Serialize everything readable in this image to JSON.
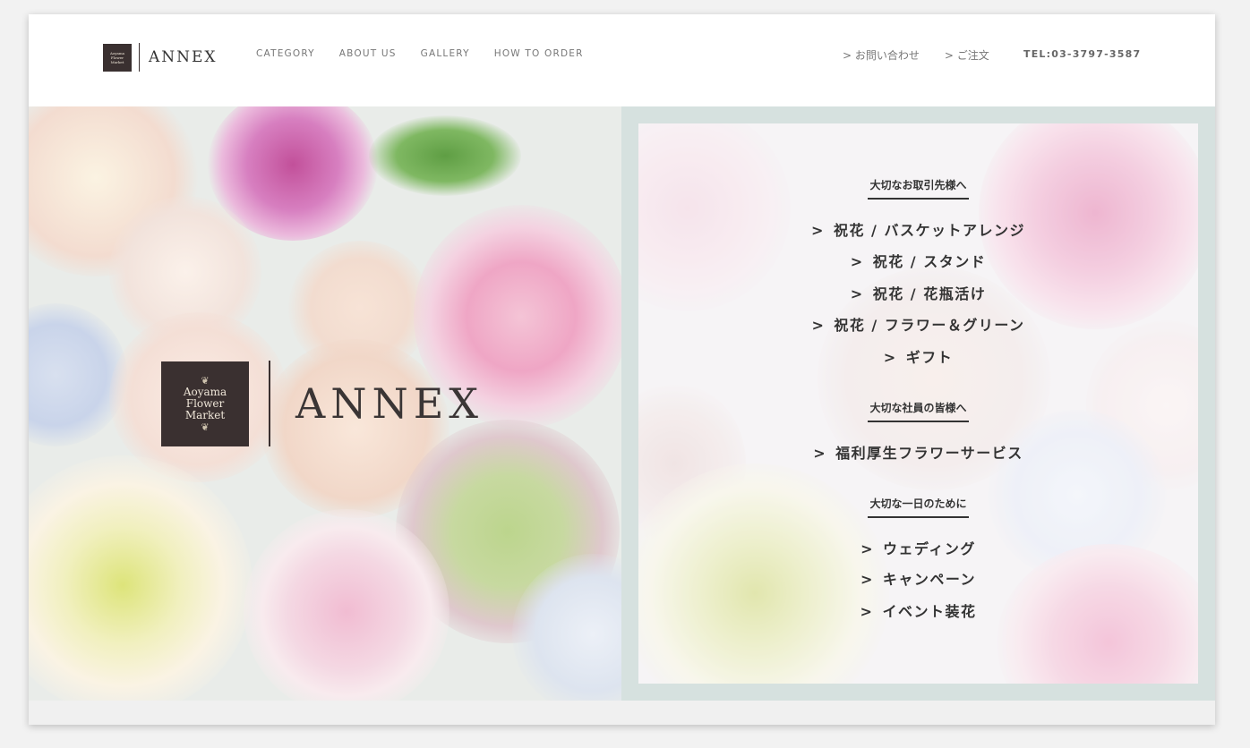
{
  "header": {
    "logo_badge_line1": "Aoyama",
    "logo_badge_line2": "Flower",
    "logo_badge_line3": "Market",
    "logo_text": "ANNEX",
    "nav": [
      "CATEGORY",
      "ABOUT US",
      "GALLERY",
      "HOW TO ORDER"
    ],
    "contact_label": "> お問い合わせ",
    "order_label": "> ご注文",
    "tel": "TEL:03-3797-3587"
  },
  "hero": {
    "badge_line1": "Aoyama",
    "badge_line2": "Flower",
    "badge_line3": "Market",
    "brand": "ANNEX"
  },
  "menu": {
    "section1_heading": "大切なお取引先様へ",
    "section1_links": [
      "祝花 / バスケットアレンジ",
      "祝花 / スタンド",
      "祝花 / 花瓶活け",
      "祝花 / フラワー＆グリーン",
      "ギフト"
    ],
    "section2_heading": "大切な社員の皆様へ",
    "section2_links": [
      "福利厚生フラワーサービス"
    ],
    "section3_heading": "大切な一日のために",
    "section3_links": [
      "ウェディング",
      "キャンペーン",
      "イベント装花"
    ],
    "arrow": ">"
  },
  "colors": {
    "brand_dark": "#3a3030",
    "panel_border": "#d6e1df"
  }
}
